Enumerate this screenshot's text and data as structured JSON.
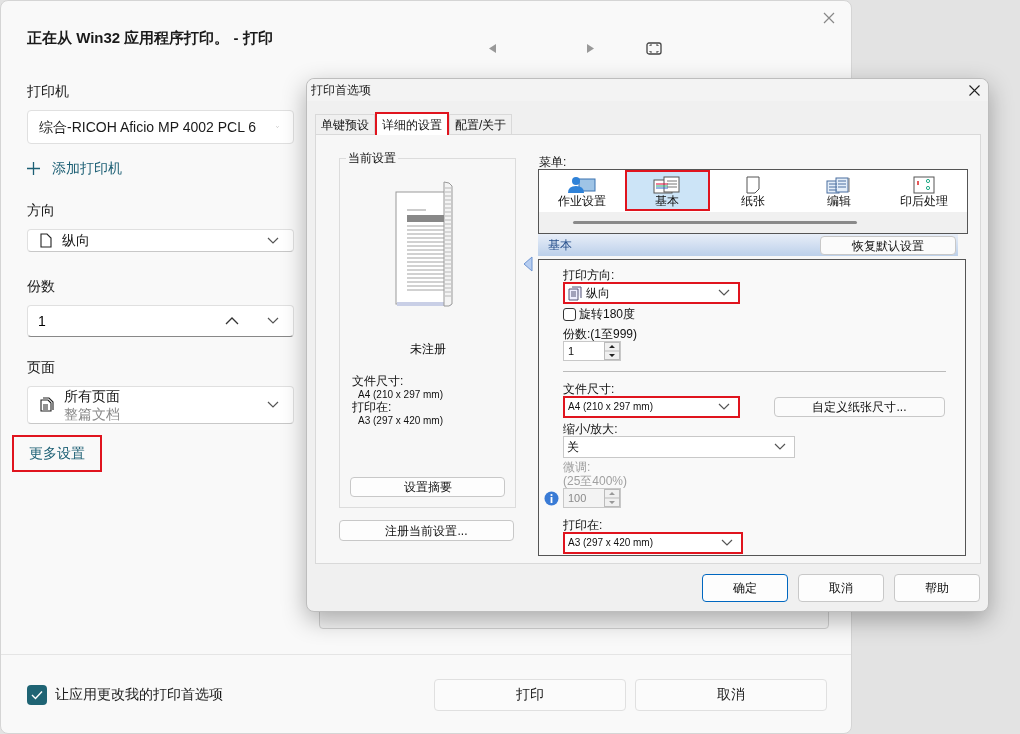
{
  "print_dialog": {
    "title": "正在从 Win32 应用程序打印。 - 打印",
    "printer": {
      "label": "打印机",
      "value": "综合-RICOH Aficio MP 4002 PCL 6"
    },
    "add_printer": "添加打印机",
    "orientation": {
      "label": "方向",
      "value": "纵向"
    },
    "copies": {
      "label": "份数",
      "value": "1"
    },
    "pages": {
      "label": "页面",
      "value": "所有页面",
      "hint": "整篇文档"
    },
    "more_settings": {
      "label": "更多设置",
      "highlighted": true
    },
    "allow_changes": {
      "label": "让应用更改我的打印首选项",
      "checked": true
    },
    "buttons": [
      "打印",
      "取消"
    ]
  },
  "preferences_dialog": {
    "title": "打印首选项",
    "tabs": [
      {
        "label": "单键预设",
        "selected": false,
        "highlighted": false
      },
      {
        "label": "详细的设置",
        "selected": true,
        "highlighted": true
      },
      {
        "label": "配置/关于",
        "selected": false,
        "highlighted": false
      }
    ],
    "current_settings": {
      "title": "当前设置",
      "status": "未注册",
      "lines": [
        {
          "label": "文件尺寸:",
          "value": "A4 (210 x 297 mm)"
        },
        {
          "label": "打印在:",
          "value": "A3 (297 x 420 mm)"
        }
      ],
      "summary_button": "设置摘要"
    },
    "register_button": "注册当前设置...",
    "menu": {
      "label": "菜单:",
      "items": [
        {
          "kind": "job",
          "label": "作业设置",
          "selected": false,
          "highlighted": false
        },
        {
          "kind": "basic",
          "label": "基本",
          "selected": true,
          "highlighted": true
        },
        {
          "kind": "paper",
          "label": "纸张",
          "selected": false,
          "highlighted": false
        },
        {
          "kind": "edit",
          "label": "编辑",
          "selected": false,
          "highlighted": false
        },
        {
          "kind": "finishing",
          "label": "印后处理",
          "selected": false,
          "highlighted": false
        }
      ]
    },
    "section": {
      "title": "基本",
      "reset_button": "恢复默认设置"
    },
    "orientation": {
      "label": "打印方向:",
      "value": "纵向",
      "highlighted": true
    },
    "rotate": {
      "label": "旋转180度",
      "checked": false
    },
    "copies": {
      "label": "份数:(1至999)",
      "value": "1"
    },
    "paper_size": {
      "label": "文件尺寸:",
      "value": "A4 (210 x 297 mm)",
      "highlighted": true
    },
    "custom_size_button": "自定义纸张尺寸...",
    "zoom": {
      "label": "缩小/放大:",
      "value": "关"
    },
    "fine_tune": {
      "label": "微调:",
      "range": "(25至400%)",
      "value": "100",
      "disabled": true
    },
    "print_on": {
      "label": "打印在:",
      "value": "A3 (297 x 420 mm)",
      "highlighted": true
    },
    "buttons": [
      {
        "label": "确定",
        "default": true
      },
      {
        "label": "取消",
        "default": false
      },
      {
        "label": "帮助",
        "default": false
      }
    ]
  }
}
